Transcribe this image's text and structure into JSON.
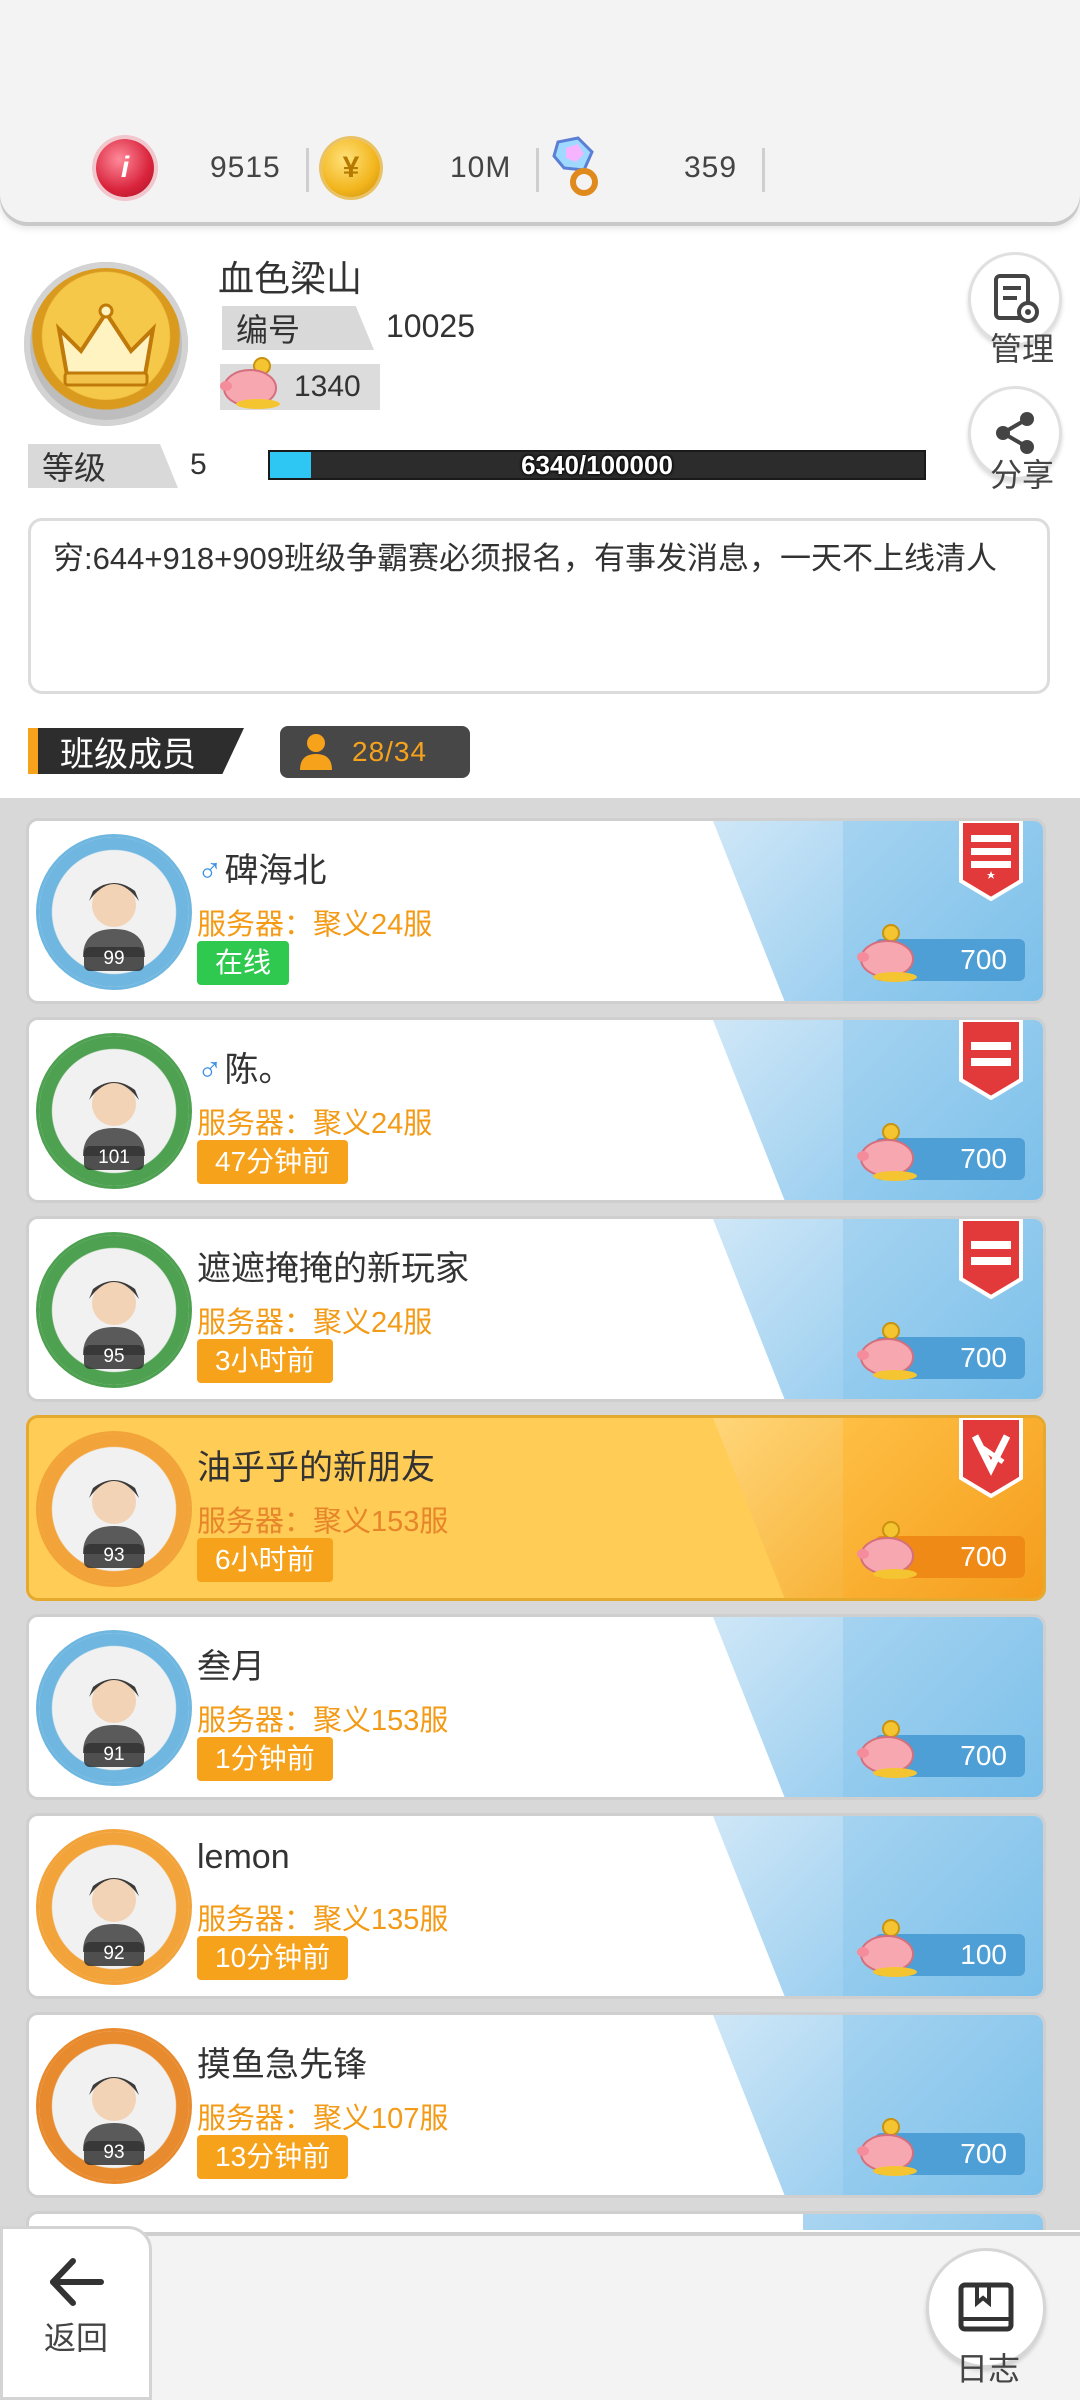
{
  "currencies": [
    {
      "icon": "ruby-coin-icon",
      "value": "9515"
    },
    {
      "icon": "gold-coin-icon",
      "value": "10M"
    },
    {
      "icon": "gem-rattle-icon",
      "value": "359"
    }
  ],
  "profile": {
    "class_name": "血色梁山",
    "id_label": "编号",
    "id_value": "10025",
    "funds_value": "1340",
    "level_label": "等级",
    "level_value": "5",
    "xp_text": "6340/100000",
    "xp_progress": 0.0634,
    "manage_label": "管理",
    "share_label": "分享"
  },
  "notice": "穷:644+918+909班级争霸赛必须报名，有事发消息，一天不上线清人",
  "members_header": {
    "title": "班级成员",
    "count": "28/34"
  },
  "members": [
    {
      "name": "碑海北",
      "male": true,
      "server": "服务器：聚义24服",
      "status": "在线",
      "online": true,
      "level": "99",
      "contribution": "700",
      "role": "leader",
      "highlight": false,
      "avatar_color": "#6fb7e0"
    },
    {
      "name": "陈。",
      "male": true,
      "server": "服务器：聚义24服",
      "status": "47分钟前",
      "online": false,
      "level": "101",
      "contribution": "700",
      "role": "officer",
      "highlight": false,
      "avatar_color": "#4da150"
    },
    {
      "name": "遮遮掩掩的新玩家",
      "male": false,
      "server": "服务器：聚义24服",
      "status": "3小时前",
      "online": false,
      "level": "95",
      "contribution": "700",
      "role": "officer",
      "highlight": false,
      "avatar_color": "#4da150"
    },
    {
      "name": "油乎乎的新朋友",
      "male": false,
      "server": "服务器：聚义153服",
      "status": "6小时前",
      "online": false,
      "level": "93",
      "contribution": "700",
      "role": "self",
      "highlight": true,
      "avatar_color": "#f2a33a"
    },
    {
      "name": "叁月",
      "male": false,
      "server": "服务器：聚义153服",
      "status": "1分钟前",
      "online": false,
      "level": "91",
      "contribution": "700",
      "role": "",
      "highlight": false,
      "avatar_color": "#6fb7e0"
    },
    {
      "name": "lemon",
      "male": false,
      "server": "服务器：聚义135服",
      "status": "10分钟前",
      "online": false,
      "level": "92",
      "contribution": "100",
      "role": "",
      "highlight": false,
      "avatar_color": "#f2a33a"
    },
    {
      "name": "摸鱼急先锋",
      "male": false,
      "server": "服务器：聚义107服",
      "status": "13分钟前",
      "online": false,
      "level": "93",
      "contribution": "700",
      "role": "",
      "highlight": false,
      "avatar_color": "#e88b2e"
    }
  ],
  "bottom": {
    "back_label": "返回",
    "log_label": "日志"
  },
  "colors": {
    "accent_orange": "#f7a21b",
    "online_green": "#2fc94f",
    "xp_blue": "#2ec6f2",
    "card_blue": "#7cc0ea"
  }
}
